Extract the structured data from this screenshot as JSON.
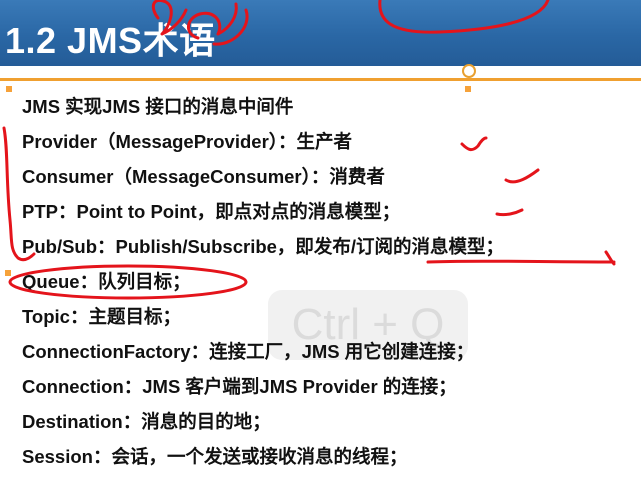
{
  "slide": {
    "title": "1.2 JMS术语",
    "watermark": "Ctrl + Q",
    "items": [
      "JMS 实现JMS 接口的消息中间件",
      "Provider（MessageProvider）：生产者",
      "Consumer（MessageConsumer）：消费者",
      "PTP：Point to Point，即点对点的消息模型；",
      "Pub/Sub：Publish/Subscribe，即发布/订阅的消息模型；",
      "Queue：队列目标；",
      "Topic：主题目标；",
      "ConnectionFactory：连接工厂，JMS 用它创建连接；",
      "Connection：JMS 客户端到JMS Provider 的连接；",
      "Destination：消息的目的地；",
      "Session：会话，一个发送或接收消息的线程；"
    ]
  },
  "colors": {
    "title_bar": "#2a67a5",
    "accent_line": "#f0a030",
    "ink": "#e4141b"
  }
}
